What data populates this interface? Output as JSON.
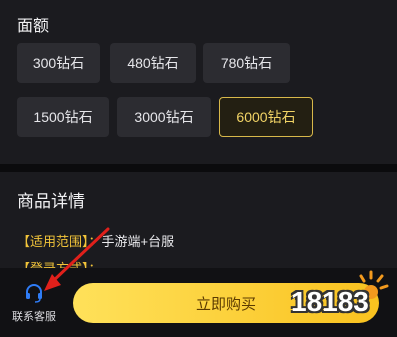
{
  "amount": {
    "title": "面额",
    "options": [
      "300钻石",
      "480钻石",
      "780钻石",
      "1500钻石",
      "3000钻石",
      "6000钻石"
    ],
    "selected": "6000钻石"
  },
  "details": {
    "title": "商品详情",
    "rows": [
      {
        "key": "【适用范围】：",
        "value": "手游端+台服"
      },
      {
        "key": "【登录方式】：",
        "value": ""
      }
    ]
  },
  "bottom_bar": {
    "customer_service": {
      "label": "联系客服",
      "icon": "headset-icon"
    },
    "buy_label": "立即购买"
  },
  "watermark": {
    "text": "18183"
  },
  "colors": {
    "accent": "#f9c21f",
    "selected_border": "#d8b84a",
    "arrow": "#e0201b",
    "service_icon": "#2f7cf6"
  }
}
